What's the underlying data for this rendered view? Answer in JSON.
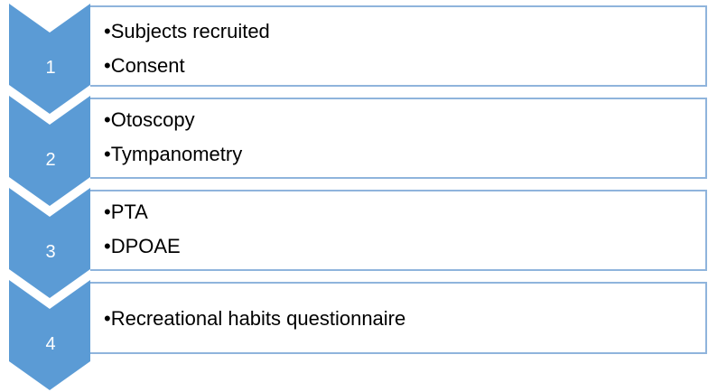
{
  "colors": {
    "chevron_fill": "#5b9bd5",
    "box_border": "#8fb4dc",
    "number_text": "#ffffff",
    "bullet_text": "#000000"
  },
  "steps": [
    {
      "number": "1",
      "bullets": [
        "Subjects recruited",
        "Consent"
      ]
    },
    {
      "number": "2",
      "bullets": [
        "Otoscopy",
        "Tympanometry"
      ]
    },
    {
      "number": "3",
      "bullets": [
        "PTA",
        "DPOAE"
      ]
    },
    {
      "number": "4",
      "bullets": [
        "Recreational habits questionnaire"
      ]
    }
  ]
}
